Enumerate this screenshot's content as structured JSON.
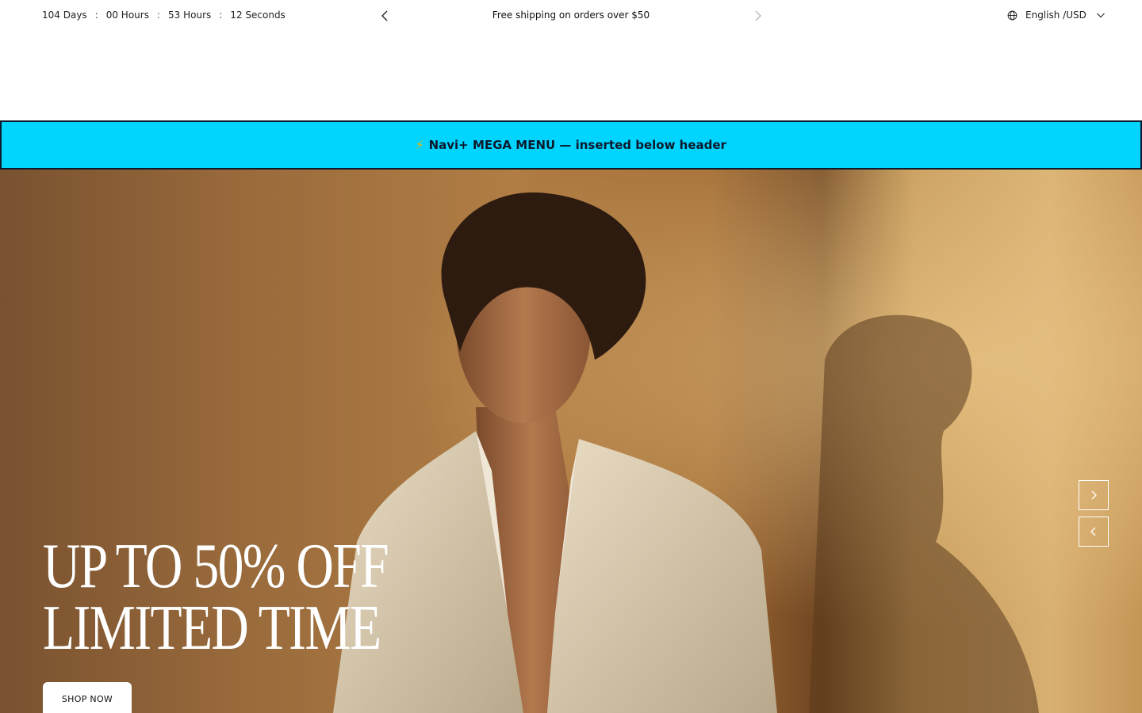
{
  "announcement": {
    "countdown": {
      "days": "104 Days",
      "hours": "00 Hours",
      "minutes": "53 Hours",
      "seconds": "12 Seconds",
      "separator": ":"
    },
    "message": "Free shipping on orders over $50",
    "language": "English /USD",
    "icons": {
      "prev": "chevron-left-icon",
      "next": "chevron-right-icon",
      "globe": "globe-icon",
      "dropdown": "chevron-down-icon"
    }
  },
  "mega_menu": {
    "icon": "⚡",
    "text": "Navi+ MEGA MENU — inserted below header",
    "background": "#00d4ff"
  },
  "hero": {
    "title_line1": "UP TO 50% OFF",
    "title_line2": "LIMITED TIME",
    "cta_label": "SHOP NOW",
    "icons": {
      "next": "chevron-right-icon",
      "prev": "chevron-left-icon"
    }
  }
}
